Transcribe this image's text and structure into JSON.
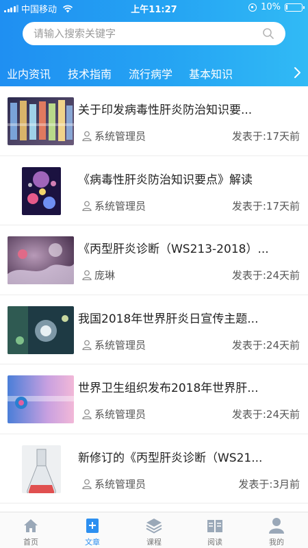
{
  "status_bar": {
    "carrier": "中国移动",
    "time": "上午11:27",
    "battery": "10%",
    "battery_level": 0.1
  },
  "search": {
    "placeholder": "请输入搜索关键字",
    "icon": "search-icon"
  },
  "tabs": [
    {
      "label": "业内资讯",
      "active": true
    },
    {
      "label": "技术指南",
      "active": false
    },
    {
      "label": "流行病学",
      "active": false
    },
    {
      "label": "基本知识",
      "active": false
    }
  ],
  "articles": [
    {
      "title": "关于印发病毒性肝炎防治知识要...",
      "author": "系统管理员",
      "date": "发表于:17天前"
    },
    {
      "title": "《病毒性肝炎防治知识要点》解读",
      "author": "系统管理员",
      "date": "发表于:17天前"
    },
    {
      "title": "《丙型肝炎诊断（WS213-2018）...",
      "author": "庞琳",
      "date": "发表于:24天前"
    },
    {
      "title": "我国2018年世界肝炎日宣传主题...",
      "author": "系统管理员",
      "date": "发表于:24天前"
    },
    {
      "title": "世界卫生组织发布2018年世界肝...",
      "author": "系统管理员",
      "date": "发表于:24天前"
    },
    {
      "title": "新修订的《丙型肝炎诊断（WS21...",
      "author": "系统管理员",
      "date": "发表于:3月前"
    }
  ],
  "tabbar": [
    {
      "label": "首页",
      "icon": "home-icon",
      "active": false
    },
    {
      "label": "文章",
      "icon": "article-icon",
      "active": true
    },
    {
      "label": "课程",
      "icon": "layers-icon",
      "active": false
    },
    {
      "label": "阅读",
      "icon": "book-icon",
      "active": false
    },
    {
      "label": "我的",
      "icon": "profile-icon",
      "active": false
    }
  ],
  "colors": {
    "header_start": "#1f8ff2",
    "header_end": "#31baf5",
    "active_tab": "#2c8ff0"
  }
}
